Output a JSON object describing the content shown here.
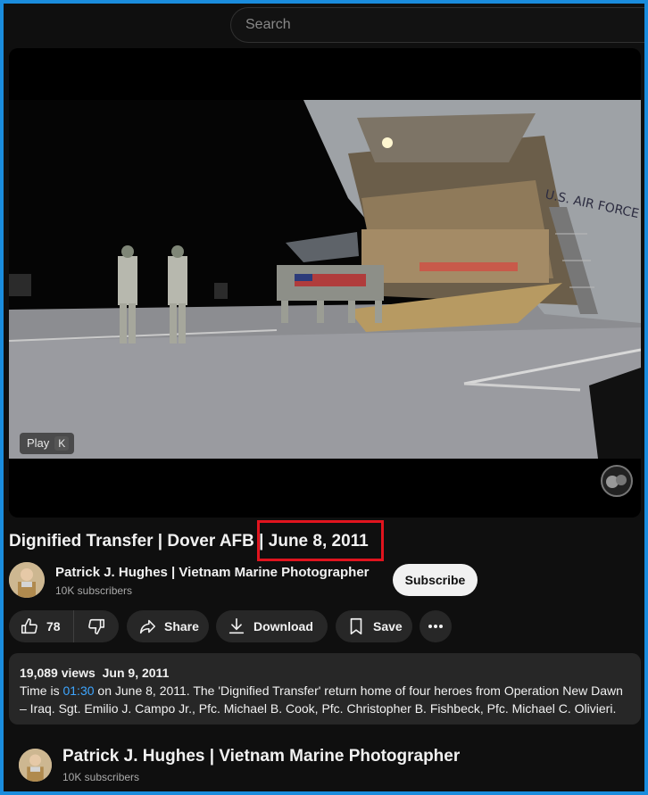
{
  "search": {
    "placeholder": "Search"
  },
  "player": {
    "play_label": "Play",
    "play_key": "K"
  },
  "video": {
    "title_main": "Dignified Transfer | Dover AFB | ",
    "title_date": "June 8, 2011"
  },
  "channel": {
    "name": "Patrick J. Hughes | Vietnam Marine Photographer",
    "subscribers": "10K subscribers",
    "subscribe_label": "Subscribe"
  },
  "actions": {
    "like_count": "78",
    "share_label": "Share",
    "download_label": "Download",
    "save_label": "Save"
  },
  "description": {
    "views": "19,089 views",
    "date": "Jun 9, 2011",
    "line_prefix": "Time is ",
    "timestamp": "01:30",
    "line_rest": " on June 8, 2011.  The 'Dignified Transfer' return home of four heroes from Operation New Dawn – Iraq.  Sgt. Emilio J. Campo Jr., Pfc.  Michael B. Cook, Pfc.  Christopher B. Fishbeck, Pfc.  Michael C. Olivieri."
  },
  "bottom_channel": {
    "name": "Patrick J. Hughes | Vietnam Marine Photographer",
    "subscribers": "10K subscribers"
  },
  "colors": {
    "accent_link": "#3ea6ff",
    "highlight_box": "#e0141e",
    "frame_border": "#1a8cdd"
  }
}
